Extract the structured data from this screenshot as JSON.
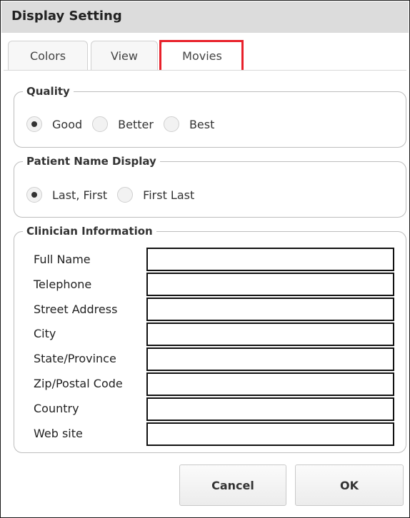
{
  "window": {
    "title": "Display Setting"
  },
  "tabs": [
    {
      "label": "Colors"
    },
    {
      "label": "View"
    },
    {
      "label": "Movies"
    }
  ],
  "quality": {
    "legend": "Quality",
    "options": [
      "Good",
      "Better",
      "Best"
    ],
    "selected": "Good"
  },
  "patient_name_display": {
    "legend": "Patient Name Display",
    "options": [
      "Last, First",
      "First Last"
    ],
    "selected": "Last, First"
  },
  "clinician": {
    "legend": "Clinician Information",
    "fields": [
      {
        "label": "Full Name",
        "value": ""
      },
      {
        "label": "Telephone",
        "value": ""
      },
      {
        "label": "Street Address",
        "value": ""
      },
      {
        "label": "City",
        "value": ""
      },
      {
        "label": "State/Province",
        "value": ""
      },
      {
        "label": "Zip/Postal Code",
        "value": ""
      },
      {
        "label": "Country",
        "value": ""
      },
      {
        "label": "Web site",
        "value": ""
      }
    ]
  },
  "buttons": {
    "cancel": "Cancel",
    "ok": "OK"
  },
  "colors": {
    "highlight": "#e8202a",
    "titlebar": "#dcdcdc"
  }
}
